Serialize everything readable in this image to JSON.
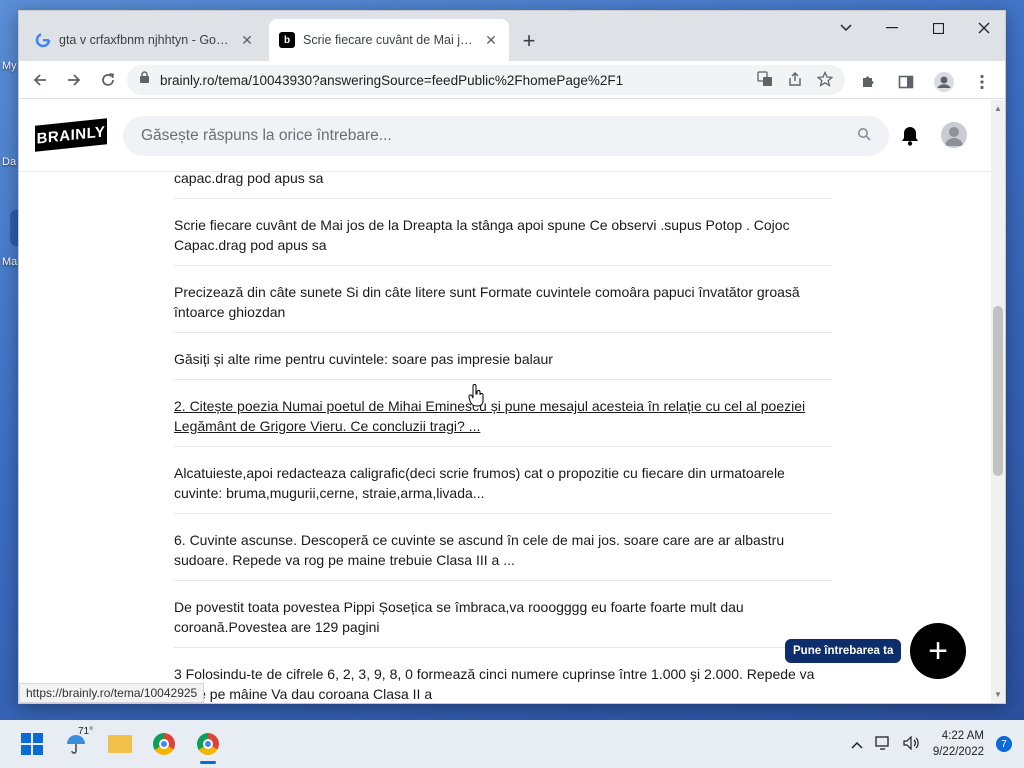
{
  "desktop": {
    "labels": [
      "My",
      "Da",
      "Ma"
    ]
  },
  "tabs": [
    {
      "title": "gta v crfaxfbnm njhhtyn - Google",
      "favicon": "google-g-icon"
    },
    {
      "title": "Scrie fiecare cuvânt de Mai jos de",
      "favicon": "brainly-b-icon"
    }
  ],
  "toolbar": {
    "url": "brainly.ro/tema/10043930?answeringSource=feedPublic%2FhomePage%2F1"
  },
  "brainly": {
    "logo": "BRAINLY",
    "search_placeholder": "Găsește răspuns la orice întrebare..."
  },
  "questions": [
    "capac.drag pod apus sa",
    "Scrie fiecare cuvânt de Mai jos de la Dreapta la stânga apoi spune Ce observi .supus Potop . Cojoc Capac.drag pod apus sa",
    "Precizează din câte sunete Si din câte litere sunt Formate cuvintele comoâra papuci învatător groasă întoarce ghiozdan",
    "Găsiți și alte rime pentru cuvintele: soare pas impresie balaur",
    "2. Citește poezia Numai poetul de Mihai Eminescu și pune mesajul acesteia în relație cu cel al poeziei Legământ de Grigore Vieru. Ce concluzii tragi? ...",
    "Alcatuieste,apoi redacteaza caligrafic(deci scrie frumos) cat o propozitie cu fiecare din urmatoarele cuvinte: bruma,mugurii,cerne, straie,arma,livada...",
    "6. Cuvinte ascunse. Descoperă ce cuvinte se ascund în cele de mai jos. soare care are ar albastru sudoare. Repede va rog pe maine trebuie Clasa III a ...",
    "De povestit toata povestea Pippi Șosețica se îmbraca,va rooogggg eu foarte foarte mult dau coroană.Povestea are 129 pagini",
    "3 Folosindu-te de cifrele 6, 2, 3, 9, 8, 0 formează cinci numere cuprinse între 1.000 şi 2.000. Repede va rog e pe mâine Va dau coroana Clasa II a"
  ],
  "ask": {
    "label": "Pune întrebarea ta",
    "plus": "+"
  },
  "status_url": "https://brainly.ro/tema/10042925",
  "taskbar": {
    "temperature": "71°",
    "time": "4:22 AM",
    "date": "9/22/2022",
    "notifications": "7"
  }
}
